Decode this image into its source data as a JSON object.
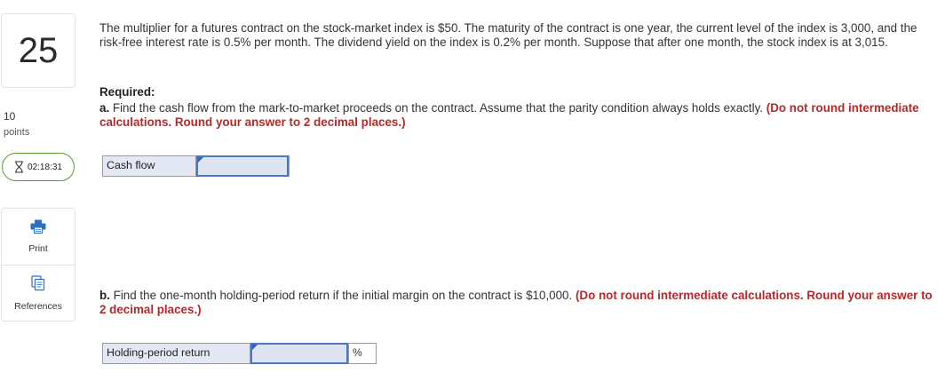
{
  "sidebar": {
    "question_number": "25",
    "points_value": "10",
    "points_label": "points",
    "timer_text": "02:18:31",
    "timer_icon": "hourglass-icon",
    "tools": [
      {
        "label": "Print",
        "icon": "printer-icon"
      },
      {
        "label": "References",
        "icon": "references-icon"
      }
    ]
  },
  "question": {
    "problem_text": "The multiplier for a futures contract on the stock-market index is $50. The maturity of the contract is one year, the current level of the index is 3,000, and the risk-free interest rate is 0.5% per month. The dividend yield on the index is 0.2% per month. Suppose that after one month, the stock index is at 3,015.",
    "required_title": "Required:",
    "part_a": {
      "label": "a.",
      "text": "Find the cash flow from the mark-to-market proceeds on the contract. Assume that the parity condition always holds exactly.",
      "note": "(Do not round intermediate calculations. Round your answer to 2 decimal places.)",
      "answer_label": "Cash flow",
      "answer_value": ""
    },
    "part_b": {
      "label": "b.",
      "text": "Find the one-month holding-period return if the initial margin on the contract is $10,000.",
      "note": "(Do not round intermediate calculations. Round your answer to 2 decimal places.)",
      "answer_label": "Holding-period return",
      "answer_value": "",
      "answer_unit": "%"
    }
  },
  "colors": {
    "accent_red": "#b42a2a",
    "timer_border": "#5a9a3a",
    "input_border": "#4a78c4",
    "input_fill": "#dfe4f3"
  }
}
